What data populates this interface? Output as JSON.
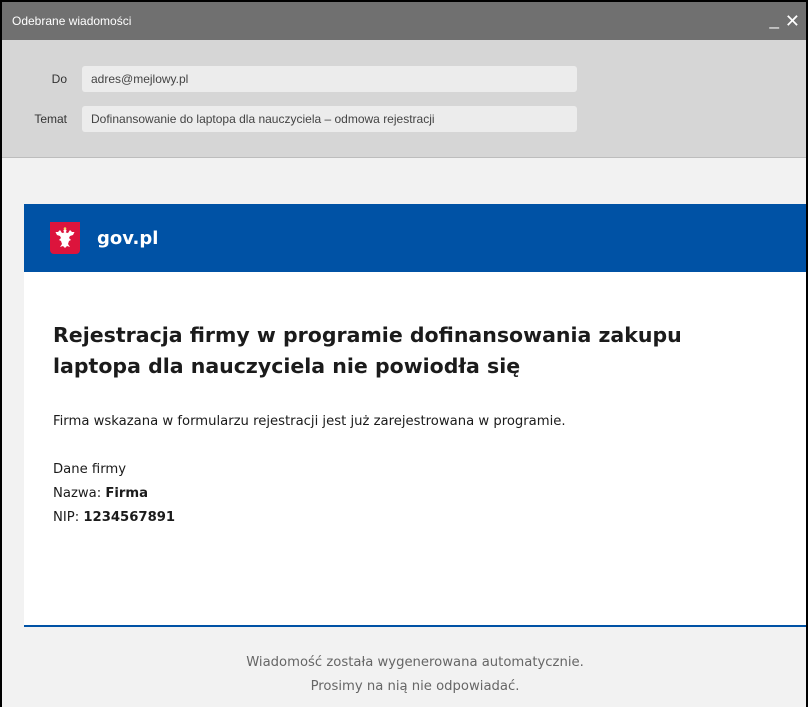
{
  "window": {
    "title": "Odebrane wiadomości",
    "minimize_glyph": "_",
    "close_glyph": "✕"
  },
  "headers": {
    "to_label": "Do",
    "to_value": "adres@mejlowy.pl",
    "subject_label": "Temat",
    "subject_value": "Dofinansowanie do laptopa dla nauczyciela – odmowa rejestracji"
  },
  "banner": {
    "brand": "gov.pl",
    "logo_icon": "polish-eagle-emblem-icon",
    "color": "#0052a5"
  },
  "message": {
    "heading": "Rejestracja firmy w programie dofinansowania zakupu laptopa dla nauczyciela nie powiodła się",
    "intro": "Firma wskazana w formularzu rejestracji jest już zarejestrowana w programie.",
    "company_section_label": "Dane firmy",
    "name_label": "Nazwa: ",
    "name_value": "Firma",
    "nip_label": "NIP: ",
    "nip_value": "1234567891"
  },
  "footer": {
    "line1": "Wiadomość została wygenerowana automatycznie.",
    "line2": "Prosimy na nią nie odpowiadać."
  }
}
